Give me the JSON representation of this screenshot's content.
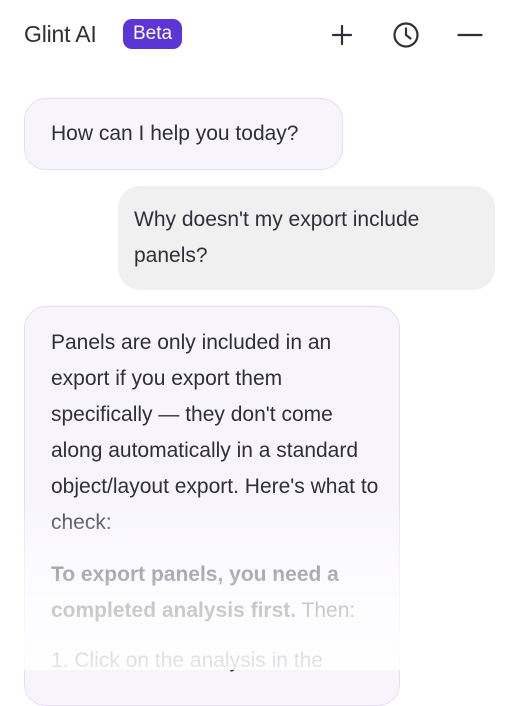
{
  "header": {
    "app_title": "Glint AI",
    "badge": "Beta",
    "new_chat_icon": "plus-icon",
    "history_icon": "clock-icon",
    "minimize_icon": "minus-icon"
  },
  "messages": [
    {
      "role": "assistant",
      "text": "How can I help you today?"
    },
    {
      "role": "user",
      "text": "Why doesn't my export include panels?"
    },
    {
      "role": "assistant",
      "paragraph_1": "Panels are only included in an export if you export them specifically — they don't come along automatically in a standard object/layout export. Here's what to check:",
      "paragraph_2_bold": "To export panels, you need a completed analysis first.",
      "paragraph_2_rest": " Then:",
      "list": [
        "1. Click on the analysis in the"
      ]
    }
  ],
  "colors": {
    "badge_bg": "#5b35d5",
    "assistant_bubble_bg": "#f7f4fe",
    "assistant_bubble_border": "#e4dcf8",
    "user_bubble_bg": "#f0f0f0"
  }
}
